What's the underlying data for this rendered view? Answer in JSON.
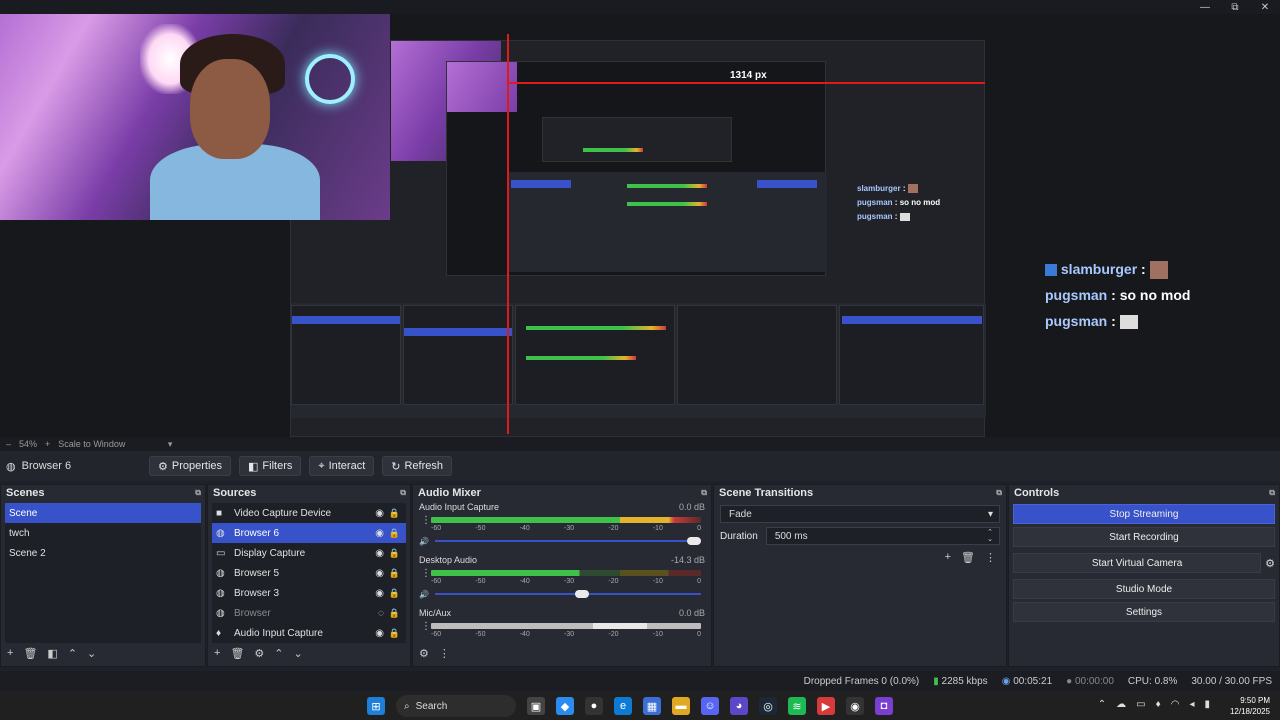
{
  "window": {
    "minimize": "—",
    "maximize": "⧉",
    "close": "✕"
  },
  "preview": {
    "measure_label": "1314 px",
    "chat_small": [
      {
        "name": "slamburger",
        "msg": ""
      },
      {
        "name": "pugsman",
        "msg": "so no mod"
      },
      {
        "name": "pugsman",
        "msg": ""
      }
    ],
    "chat_big": [
      {
        "name": "slamburger",
        "msg": ""
      },
      {
        "name": "pugsman",
        "msg": "so no mod"
      },
      {
        "name": "pugsman",
        "msg": ""
      }
    ]
  },
  "zoom": {
    "value": "54%",
    "minus": "–",
    "plus": "+",
    "mode": "Scale to Window"
  },
  "source_toolbar": {
    "source_name": "Browser 6",
    "buttons": [
      "Properties",
      "Filters",
      "Interact",
      "Refresh"
    ]
  },
  "scenes": {
    "title": "Scenes",
    "items": [
      "Scene",
      "twch",
      "Scene 2"
    ],
    "selected": 0
  },
  "sources": {
    "title": "Sources",
    "items": [
      {
        "label": "Video Capture Device",
        "icon": "camera-icon"
      },
      {
        "label": "Browser 6",
        "icon": "globe-icon"
      },
      {
        "label": "Display Capture",
        "icon": "monitor-icon"
      },
      {
        "label": "Browser 5",
        "icon": "globe-icon"
      },
      {
        "label": "Browser 3",
        "icon": "globe-icon"
      },
      {
        "label": "Browser",
        "icon": "globe-icon"
      },
      {
        "label": "Audio Input Capture",
        "icon": "mic-icon"
      }
    ],
    "selected": 1,
    "hidden": 5
  },
  "mixer": {
    "title": "Audio Mixer",
    "ticks": [
      "-60",
      "-55",
      "-50",
      "-45",
      "-40",
      "-35",
      "-30",
      "-25",
      "-20",
      "-15",
      "-10",
      "-5",
      "0"
    ],
    "channels": [
      {
        "name": "Audio Input Capture",
        "db": "0.0 dB",
        "level": 0.9,
        "volume": 1.0
      },
      {
        "name": "Desktop Audio",
        "db": "-14.3 dB",
        "level": 0.55,
        "volume": 0.58
      },
      {
        "name": "Mic/Aux",
        "db": "0.0 dB",
        "level": 0.0,
        "volume": 1.0
      }
    ]
  },
  "transitions": {
    "title": "Scene Transitions",
    "transition": "Fade",
    "duration_label": "Duration",
    "duration_value": "500 ms"
  },
  "controls": {
    "title": "Controls",
    "buttons": [
      "Stop Streaming",
      "Start Recording",
      "Start Virtual Camera",
      "Studio Mode",
      "Settings"
    ],
    "active": 0
  },
  "status": {
    "dropped": "Dropped Frames 0 (0.0%)",
    "bitrate": "2285 kbps",
    "stream_time": "00:05:21",
    "rec_time": "00:00:00",
    "cpu": "CPU: 0.8%",
    "fps": "30.00 / 30.00 FPS"
  },
  "taskbar": {
    "search_label": "Search",
    "time": "9:50 PM",
    "date": "12/18/2025"
  },
  "colors": {
    "accent": "#3853c9",
    "meter_green": "#3fc24a",
    "meter_yellow": "#e3b42c",
    "meter_red": "#c93a3a"
  }
}
